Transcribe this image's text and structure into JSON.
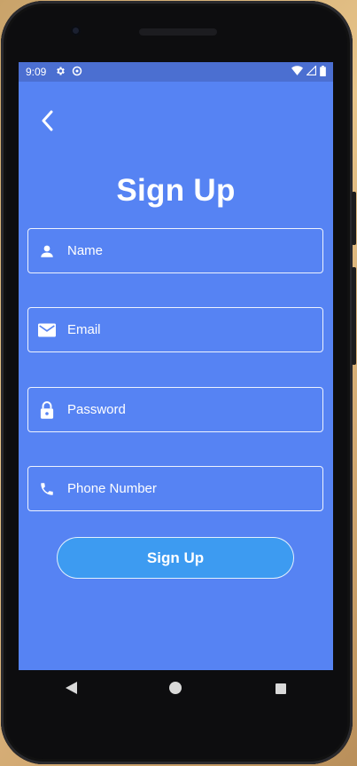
{
  "status_bar": {
    "time": "9:09",
    "icons_left": [
      "settings-icon",
      "sync-icon"
    ],
    "icons_right": [
      "wifi-icon",
      "signal-icon",
      "battery-icon"
    ]
  },
  "header": {
    "back_icon": "chevron-left-icon",
    "title": "Sign Up"
  },
  "form": {
    "fields": [
      {
        "icon": "person-icon",
        "placeholder": "Name",
        "value": ""
      },
      {
        "icon": "mail-icon",
        "placeholder": "Email",
        "value": ""
      },
      {
        "icon": "lock-icon",
        "placeholder": "Password",
        "value": ""
      },
      {
        "icon": "phone-icon",
        "placeholder": "Phone Number",
        "value": ""
      }
    ],
    "submit_label": "Sign Up"
  },
  "nav_bar": {
    "items": [
      "back-triangle-icon",
      "home-circle-icon",
      "recents-square-icon"
    ]
  },
  "colors": {
    "screen_bg": "#5683f3",
    "status_bar_bg": "#4b6fd1",
    "button_bg": "#3d9bf1",
    "text": "#ffffff"
  }
}
